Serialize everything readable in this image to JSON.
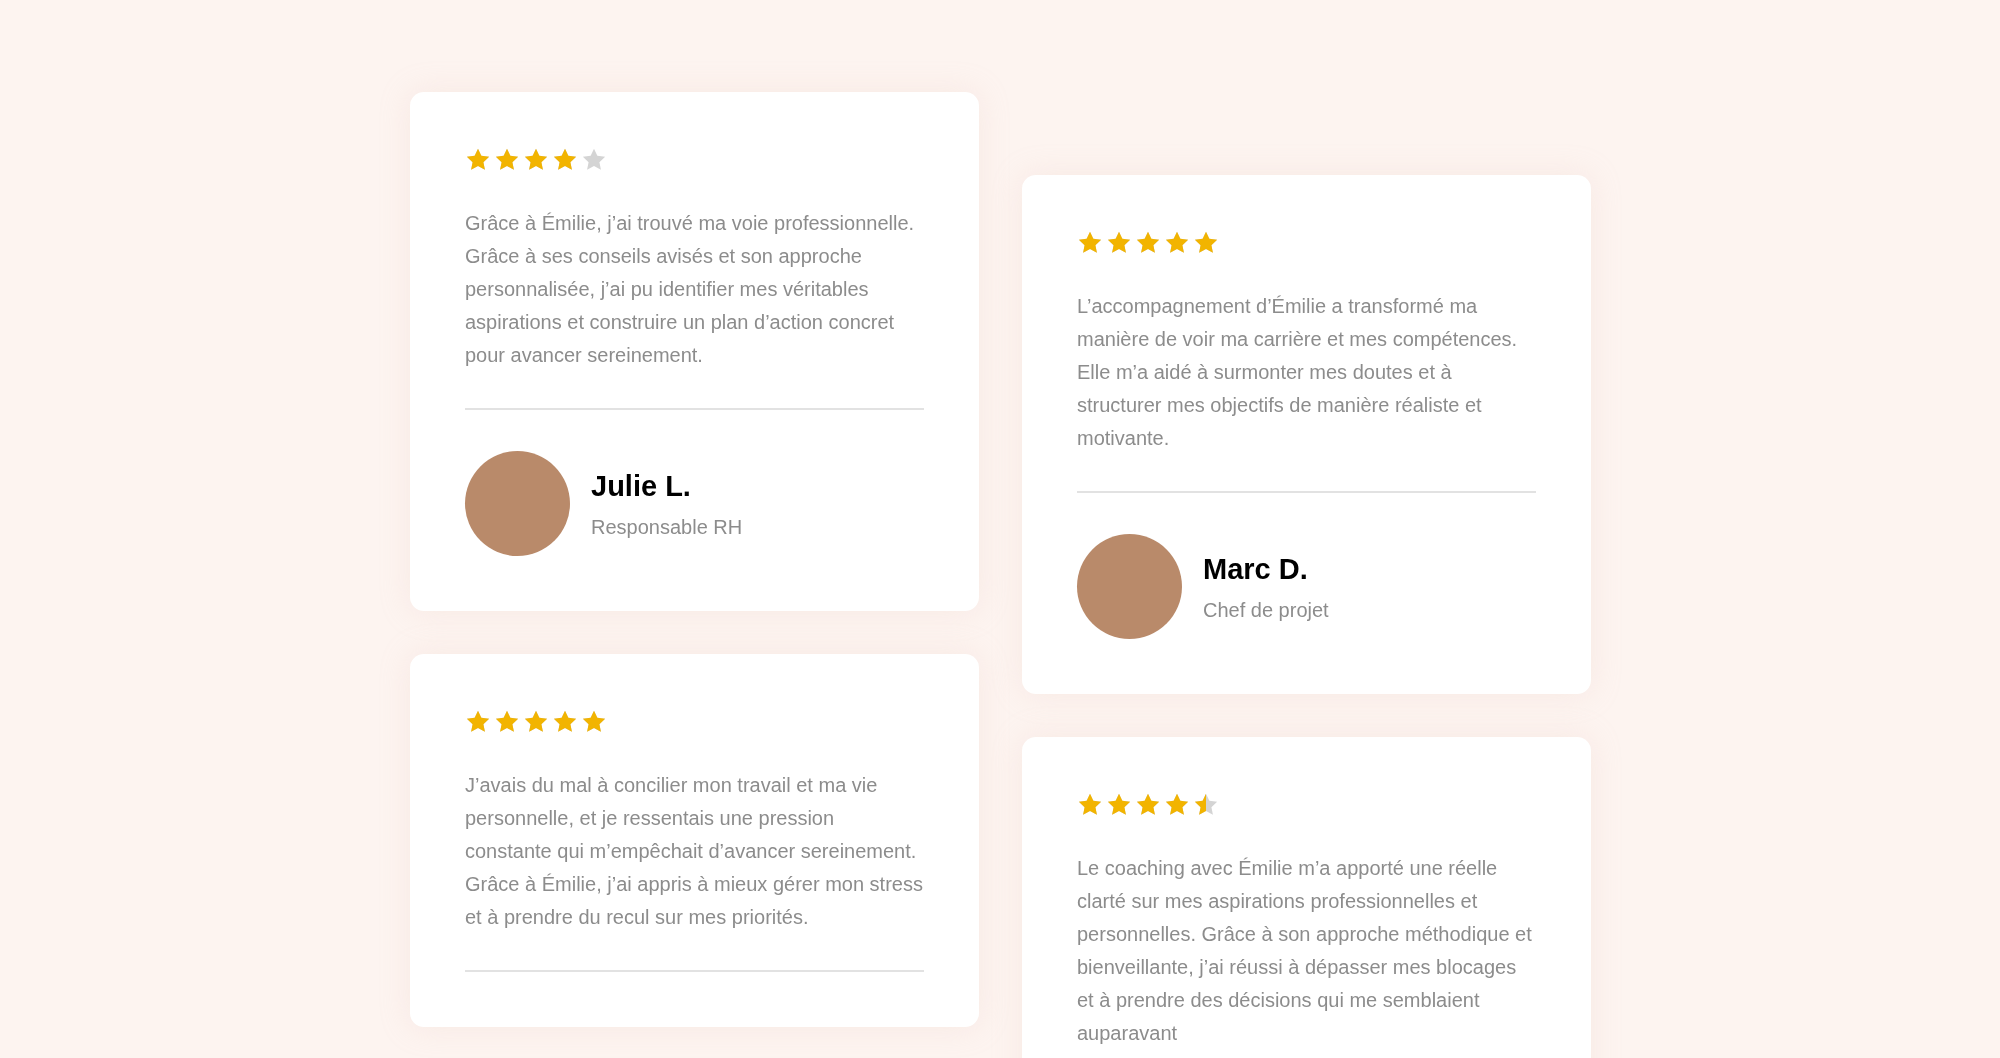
{
  "testimonials": [
    {
      "stars": 4,
      "text": "Grâce à Émilie, j’ai trouvé ma voie professionnelle. Grâce à ses conseils avisés et son approche personnalisée, j’ai pu identifier mes véritables aspirations et construire un plan d’action concret pour avancer sereinement.",
      "name": "Julie L.",
      "role": "Responsable RH"
    },
    {
      "stars": 5,
      "text": "L’accompagnement d’Émilie a transformé ma manière de voir ma carrière et mes compétences. Elle m’a aidé à surmonter mes doutes et à structurer mes objectifs de manière réaliste et motivante.",
      "name": "Marc D.",
      "role": "Chef de projet"
    },
    {
      "stars": 5,
      "text": "J’avais du mal à concilier mon travail et ma vie personnelle, et je ressentais une pression constante qui m’empêchait d’avancer sereinement. Grâce à Émilie, j’ai appris à mieux gérer mon stress et à prendre du recul sur mes priorités."
    },
    {
      "stars": 4.5,
      "text": "Le coaching avec Émilie m’a apporté une réelle clarté sur mes aspirations professionnelles et personnelles. Grâce à son approche méthodique et bienveillante, j’ai réussi à dépasser mes blocages et à prendre des décisions qui me semblaient auparavant"
    }
  ]
}
